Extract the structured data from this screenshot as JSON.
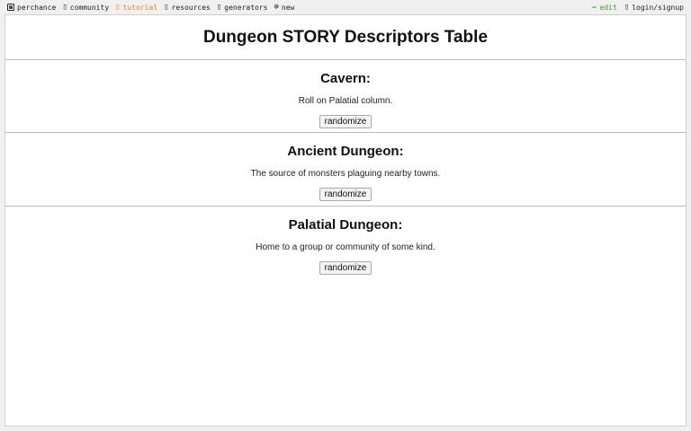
{
  "topbar": {
    "brand": "perchance",
    "community": "community",
    "tutorial": "tutorial",
    "resources": "resources",
    "generators": "generators",
    "new": "new",
    "edit": "edit",
    "login": "login/signup",
    "colors": {
      "tutorial": "#e8801a",
      "edit": "#3a9a2a"
    }
  },
  "page": {
    "title": "Dungeon STORY Descriptors Table"
  },
  "sections": [
    {
      "heading": "Cavern:",
      "text": "Roll on Palatial column.",
      "button": "randomize"
    },
    {
      "heading": "Ancient Dungeon:",
      "text": "The source of monsters plaguing nearby towns.",
      "button": "randomize"
    },
    {
      "heading": "Palatial Dungeon:",
      "text": "Home to a group or community of some kind.",
      "button": "randomize"
    }
  ]
}
